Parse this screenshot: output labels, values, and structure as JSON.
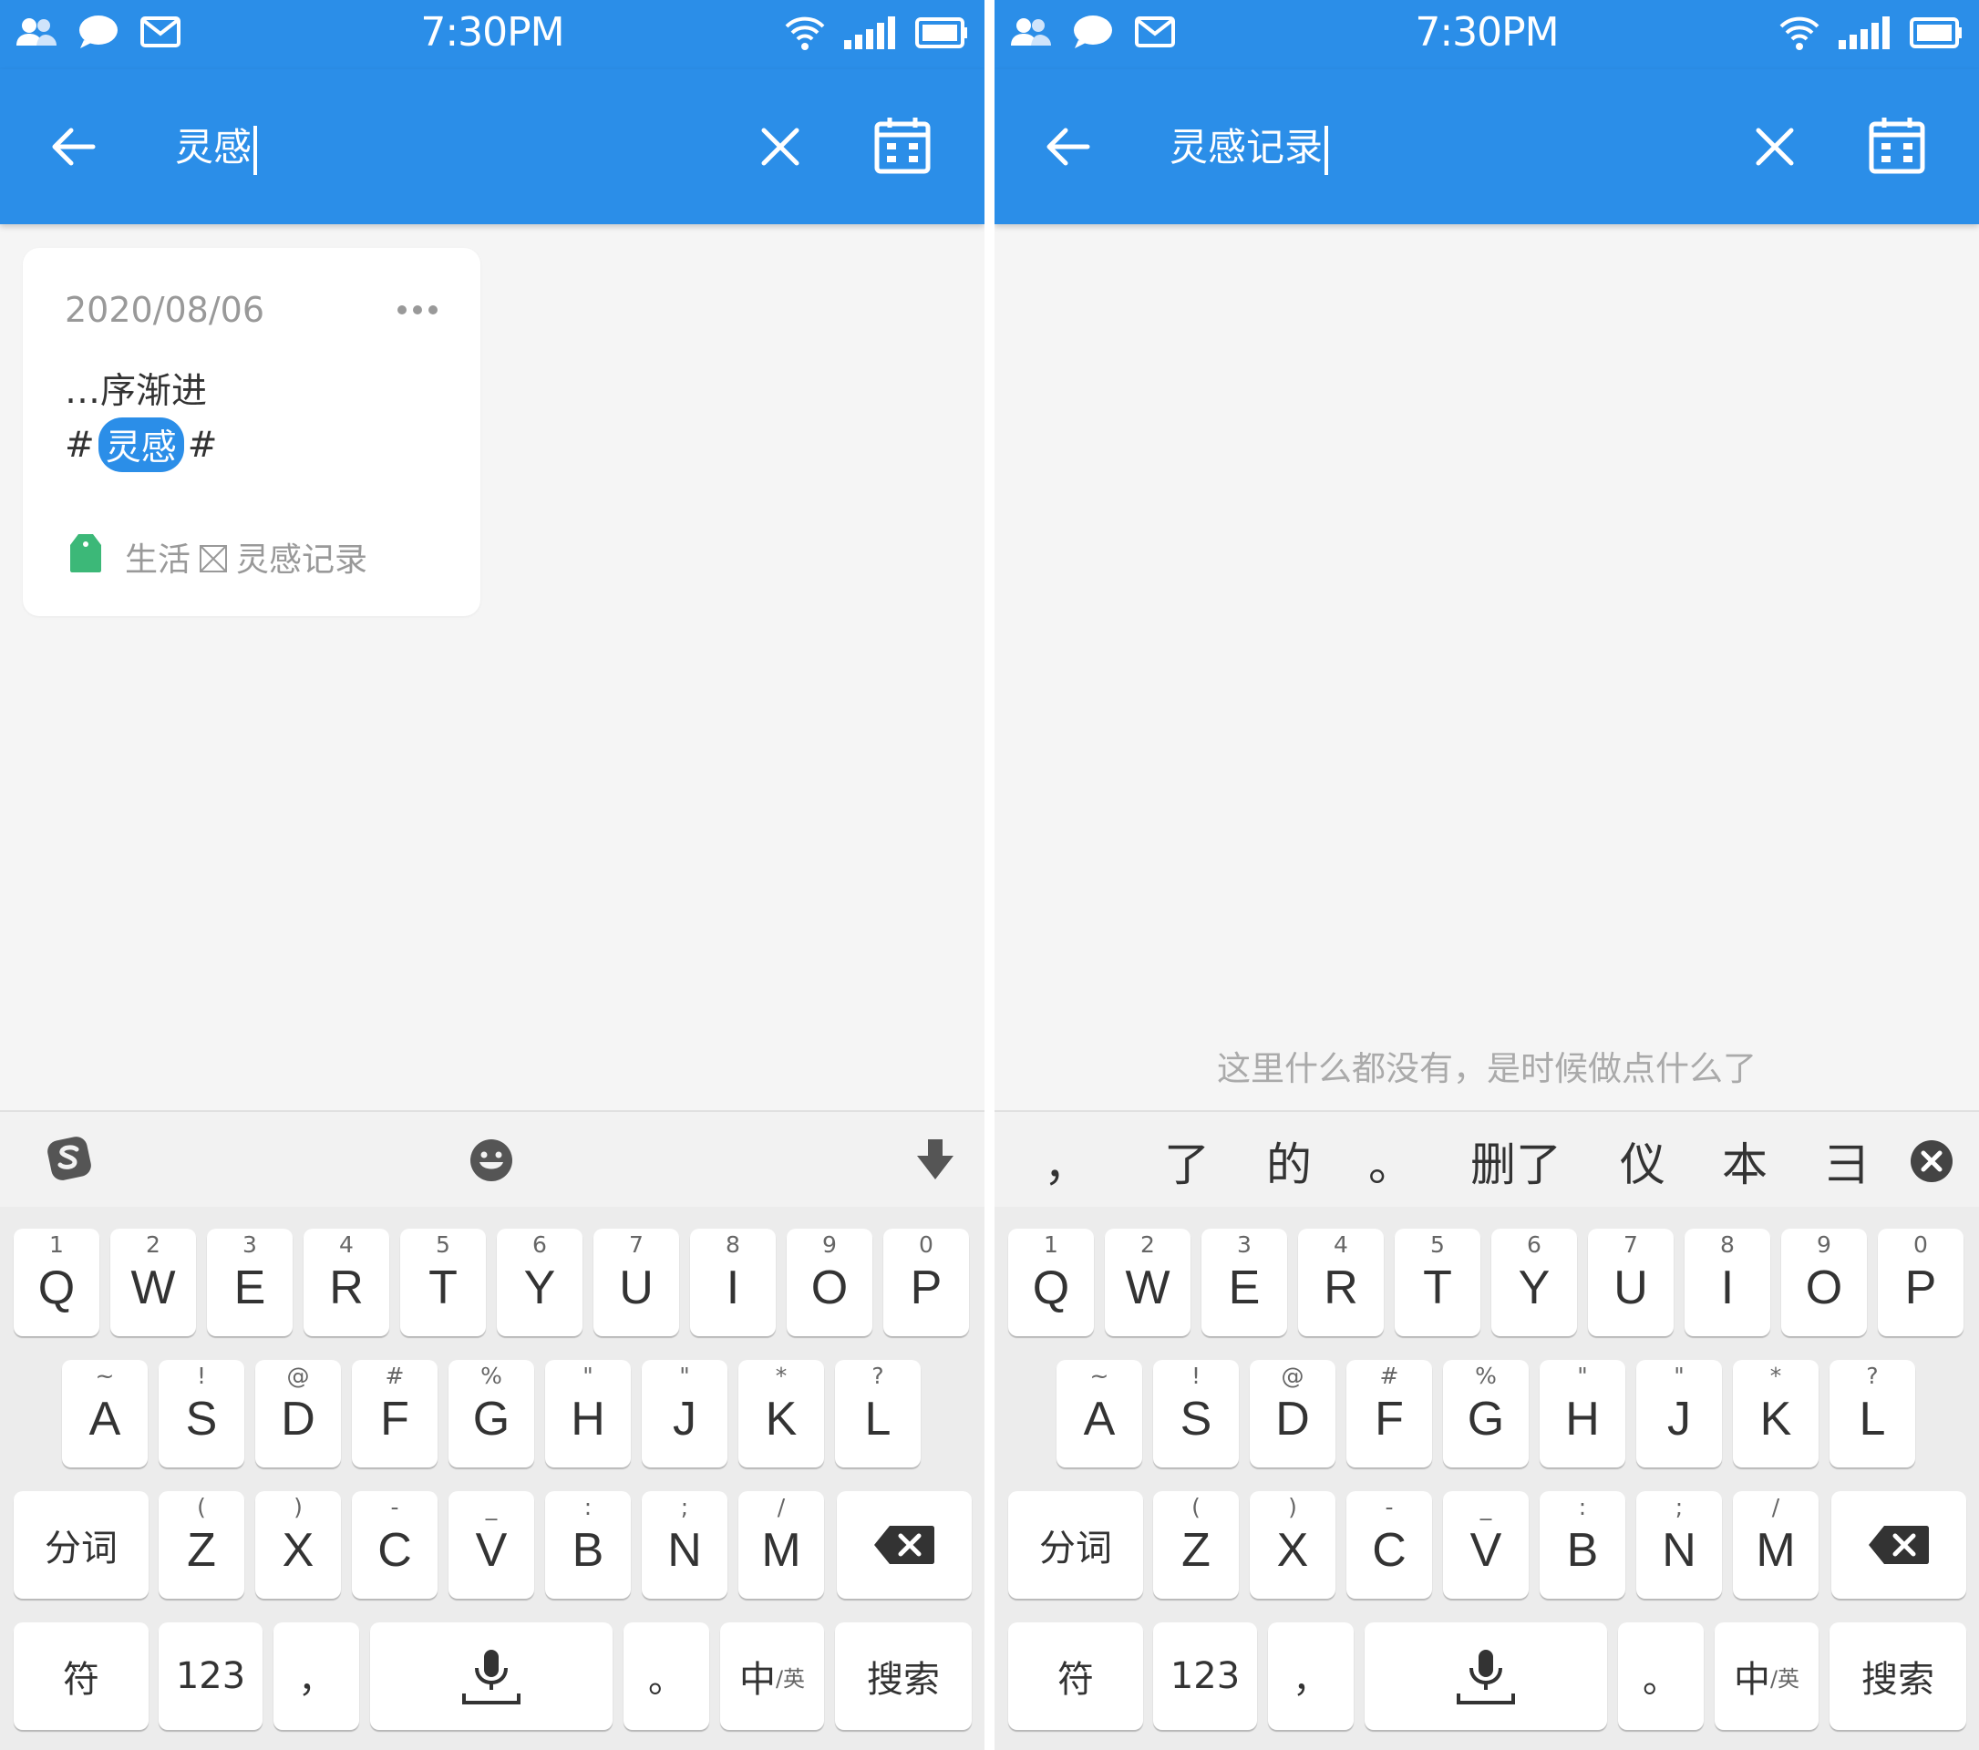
{
  "status_bar": {
    "time": "7:30PM"
  },
  "left": {
    "search_text": "灵感",
    "note": {
      "date": "2020/08/06",
      "snippet": "…序渐进",
      "hash_before": "#",
      "highlight": "灵感",
      "hash_after": "#",
      "notebook": "生活",
      "folder": "灵感记录"
    },
    "keyboard_mode": "toolbar"
  },
  "right": {
    "search_text": "灵感记录",
    "empty_message": "这里什么都没有，是时候做点什么了",
    "candidates": [
      "，",
      "了",
      "的",
      "。",
      "删了",
      "仪",
      "本",
      "彐"
    ]
  },
  "keyboard": {
    "row1": [
      {
        "sub": "1",
        "main": "Q"
      },
      {
        "sub": "2",
        "main": "W"
      },
      {
        "sub": "3",
        "main": "E"
      },
      {
        "sub": "4",
        "main": "R"
      },
      {
        "sub": "5",
        "main": "T"
      },
      {
        "sub": "6",
        "main": "Y"
      },
      {
        "sub": "7",
        "main": "U"
      },
      {
        "sub": "8",
        "main": "I"
      },
      {
        "sub": "9",
        "main": "O"
      },
      {
        "sub": "0",
        "main": "P"
      }
    ],
    "row2": [
      {
        "sub": "~",
        "main": "A"
      },
      {
        "sub": "!",
        "main": "S"
      },
      {
        "sub": "@",
        "main": "D"
      },
      {
        "sub": "#",
        "main": "F"
      },
      {
        "sub": "%",
        "main": "G"
      },
      {
        "sub": "\"",
        "main": "H"
      },
      {
        "sub": "\"",
        "main": "J"
      },
      {
        "sub": "*",
        "main": "K"
      },
      {
        "sub": "?",
        "main": "L"
      }
    ],
    "row3": [
      {
        "sub": "(",
        "main": "Z"
      },
      {
        "sub": ")",
        "main": "X"
      },
      {
        "sub": "-",
        "main": "C"
      },
      {
        "sub": "_",
        "main": "V"
      },
      {
        "sub": ":",
        "main": "B"
      },
      {
        "sub": ";",
        "main": "N"
      },
      {
        "sub": "/",
        "main": "M"
      }
    ],
    "segment_label": "分词",
    "symbol_label": "符",
    "num_label": "123",
    "comma_label": "，",
    "period_label": "。",
    "lang_main": "中",
    "lang_sub": "/英",
    "search_label": "搜索"
  },
  "colors": {
    "primary": "#2b8ee8",
    "tag_green": "#3cb878"
  }
}
